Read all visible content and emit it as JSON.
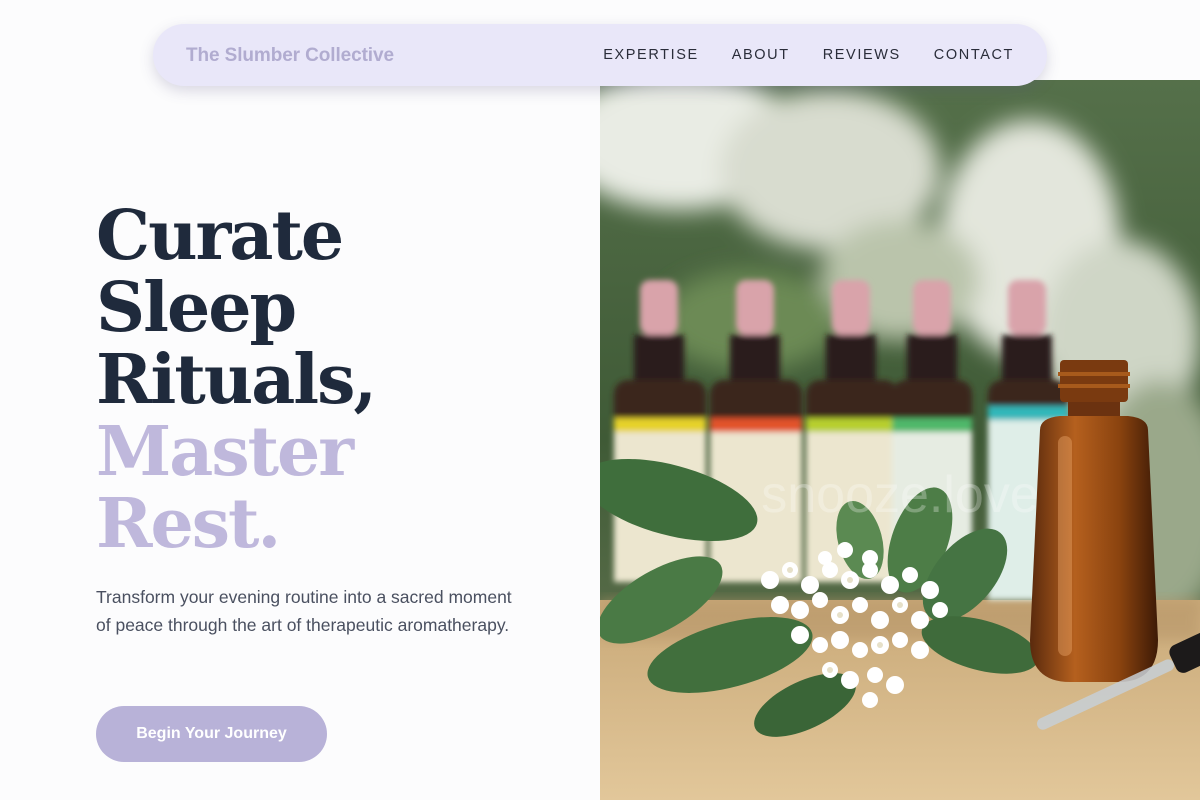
{
  "nav": {
    "brand": "The Slumber Collective",
    "links": [
      "EXPERTISE",
      "ABOUT",
      "REVIEWS",
      "CONTACT"
    ]
  },
  "hero": {
    "headline_dark": [
      "Curate",
      "Sleep",
      "Rituals,"
    ],
    "headline_soft": [
      "Master",
      "Rest."
    ],
    "subtext": "Transform your evening routine into a sacred moment of peace through the art of therapeutic aromatherapy.",
    "cta_label": "Begin Your Journey",
    "image_watermark": "snooze.love"
  },
  "colors": {
    "nav_bg": "#e9e7f9",
    "brand_text": "#b1acd0",
    "headline_dark": "#1f2a3c",
    "headline_soft": "#bfb8dc",
    "cta_bg": "#b8b2d8"
  }
}
